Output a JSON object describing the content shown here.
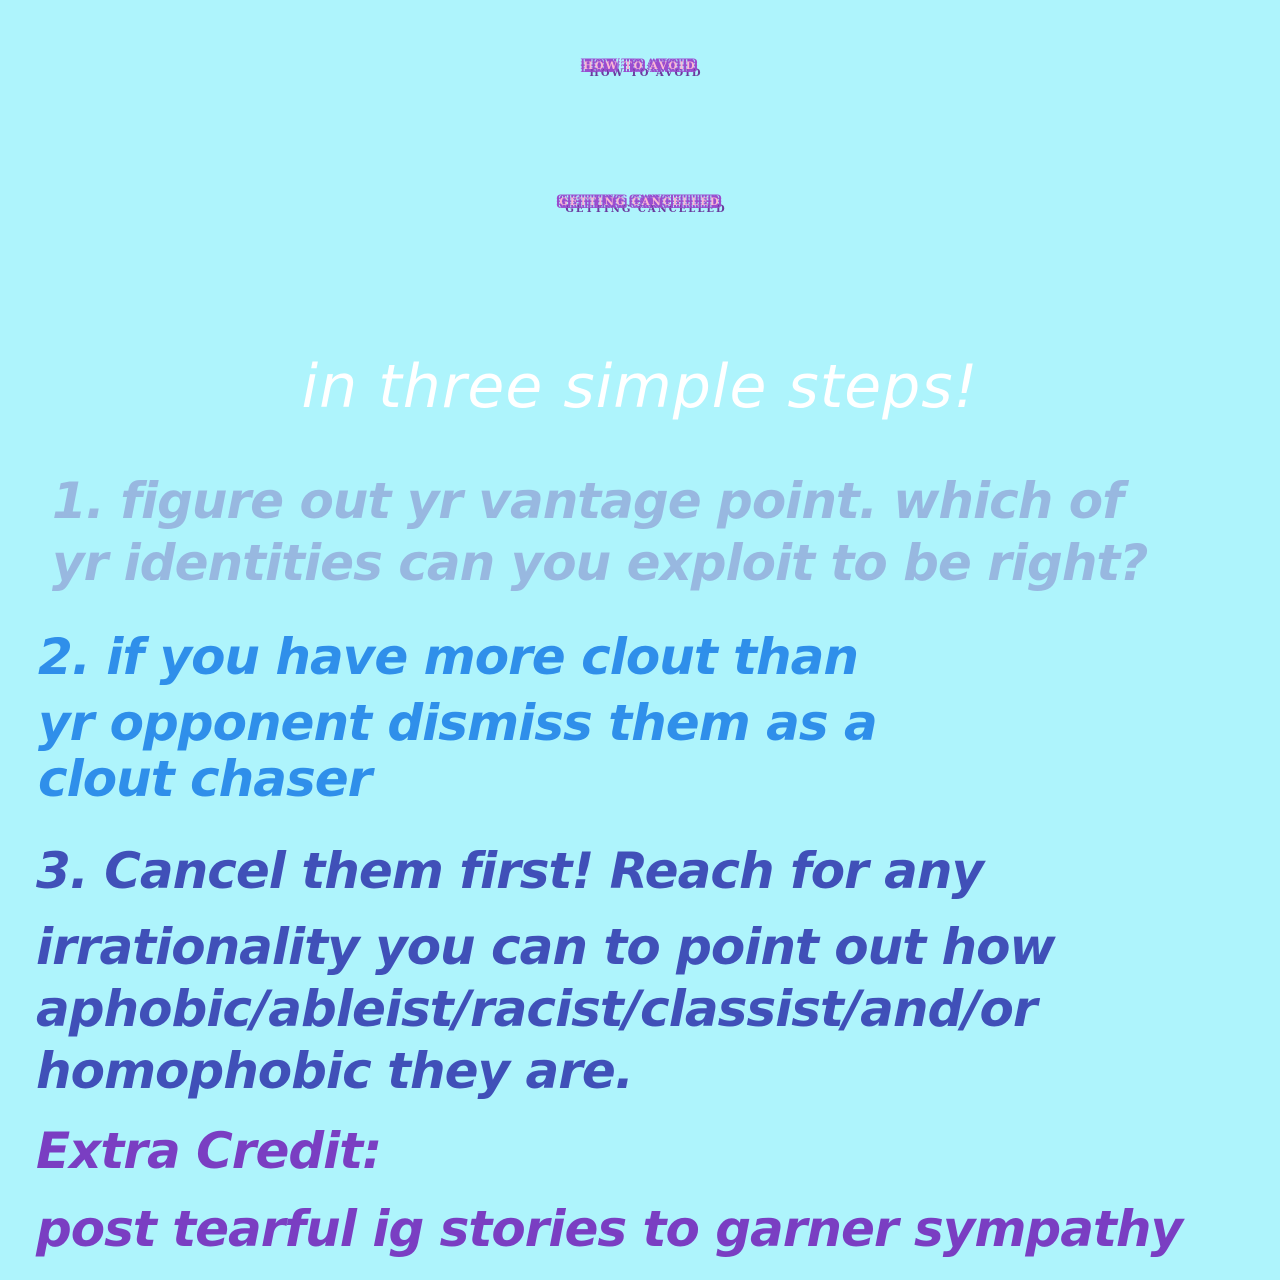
{
  "title": {
    "line1": "How to avoid",
    "line2": "getting cancelled"
  },
  "subtitle": "in three simple steps!",
  "steps": {
    "one": {
      "line1": "1. figure out yr vantage point. which of",
      "line2": "yr identities can you exploit to be right?"
    },
    "two": {
      "line1": "2. if you have more clout than",
      "line2": "yr opponent dismiss them as a",
      "line3": "clout chaser"
    },
    "three": {
      "line1": "3. Cancel them first! Reach for any",
      "line2": "irrationality you can to point out how",
      "line3": "aphobic/ableist/racist/classist/and/or",
      "line4": "homophobic they are."
    }
  },
  "extra_credit": {
    "heading": "Extra Credit:",
    "text": "post tearful ig stories to garner sympathy"
  },
  "colors": {
    "background": "#aef4fc",
    "title_fill": "#fbb6d4",
    "title_outline": "#9a4ccf",
    "step1": "#98b8e0",
    "step2": "#2f8fea",
    "step3": "#4050b8",
    "extra": "#7a3ec2"
  }
}
